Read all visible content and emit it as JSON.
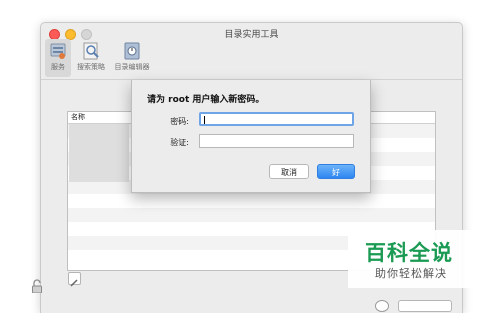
{
  "window": {
    "title": "目录实用工具"
  },
  "toolbar": {
    "items": [
      {
        "label": "服务",
        "icon": "services-icon"
      },
      {
        "label": "搜索策略",
        "icon": "search-policy-icon"
      },
      {
        "label": "目录编辑器",
        "icon": "directory-editor-icon"
      }
    ]
  },
  "table": {
    "column_header": "名称"
  },
  "dialog": {
    "title": "请为 root 用户输入新密码。",
    "password_label": "密码:",
    "verify_label": "验证:",
    "password_value": "",
    "verify_value": "",
    "cancel_label": "取消",
    "ok_label": "好"
  },
  "watermark": {
    "main": "百科全说",
    "sub": "助你轻松解决"
  },
  "colors": {
    "accent": "#2e86f0",
    "watermark_green": "#1a9a52"
  }
}
